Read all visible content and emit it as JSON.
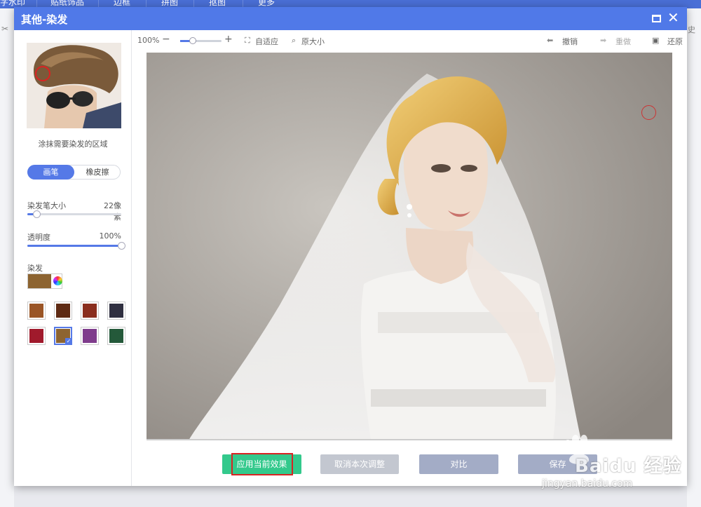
{
  "app_tabs": [
    "字水印",
    "贴纸饰品",
    "边框",
    "拼图",
    "抠图",
    "更多"
  ],
  "background_right_text": "史",
  "dialog": {
    "title": "其他-染发"
  },
  "sidebar": {
    "hint": "涂抹需要染发的区域",
    "mode_toggle": {
      "active": "画笔",
      "inactive": "橡皮擦"
    },
    "brush_size": {
      "label": "染发笔大小",
      "value": "22像素",
      "level": 0.1
    },
    "opacity": {
      "label": "透明度",
      "value": "100%",
      "level": 1.0
    },
    "color_section_label": "染发",
    "current_color": "#8d6431",
    "swatches": [
      {
        "color": "#9a5526",
        "selected": false
      },
      {
        "color": "#5e2a13",
        "selected": false
      },
      {
        "color": "#8a2e1e",
        "selected": false
      },
      {
        "color": "#2f2f40",
        "selected": false
      },
      {
        "color": "#a01a2c",
        "selected": false
      },
      {
        "color": "#8d6431",
        "selected": true
      },
      {
        "color": "#7f3c8c",
        "selected": false
      },
      {
        "color": "#24593a",
        "selected": false
      }
    ]
  },
  "toolbar": {
    "zoom_value": "100%",
    "zoom_level": 0.3,
    "fit_label": "自适应",
    "original_size_label": "原大小",
    "undo_label": "撤销",
    "redo_label": "重做",
    "restore_label": "还原"
  },
  "buttons": {
    "apply": "应用当前效果",
    "cancel": "取消本次调整",
    "compare": "对比",
    "save": "保存"
  },
  "watermark": {
    "text": "Baidu 经验",
    "url": "jingyan.baidu.com"
  },
  "colors": {
    "accent": "#5079e8",
    "apply_green": "#33c98c"
  }
}
